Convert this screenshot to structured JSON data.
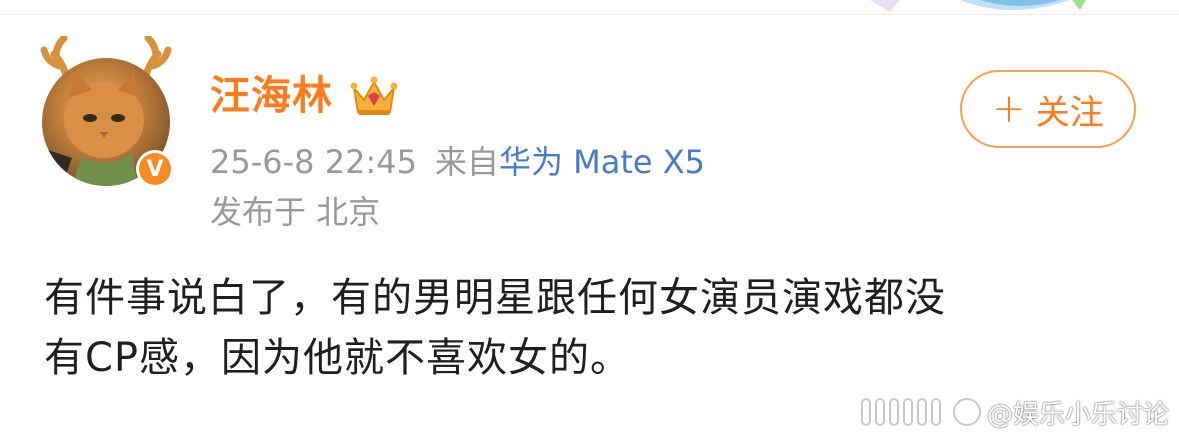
{
  "user": {
    "name": "汪海林",
    "verified": "V"
  },
  "meta": {
    "timestamp": "25-6-8 22:45",
    "source_prefix": "来自",
    "source": "华为 Mate X5",
    "location": "发布于 北京"
  },
  "follow_button": {
    "plus": "+",
    "label": "关注"
  },
  "post": {
    "lines": [
      "有件事说白了，有的男明星跟任何女演员演戏都没",
      "有CP感，因为他就不喜欢女的。"
    ]
  },
  "watermark": {
    "text": "@娱乐小乐讨论"
  },
  "colors": {
    "username": "#ff7a1a",
    "follow_border": "#f7a04a",
    "source_link": "#4a7bc8",
    "meta_gray": "#999999",
    "body_text": "#1f1f1f"
  },
  "icons": {
    "crown": "crown-icon",
    "verified": "verified-badge-icon",
    "antlers": "antler-icon",
    "plus": "plus-icon"
  }
}
